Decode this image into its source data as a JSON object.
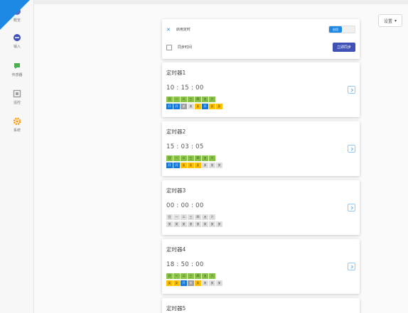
{
  "sidebar": {
    "items": [
      {
        "label": "概览",
        "icon": "dashboard-icon",
        "color": "#5c6bc0"
      },
      {
        "label": "输入",
        "icon": "input-icon",
        "color": "#3f51b5"
      },
      {
        "label": "传感器",
        "icon": "sensor-icon",
        "color": "#4caf50"
      },
      {
        "label": "遥控",
        "icon": "remote-icon",
        "color": "#9e9e9e"
      },
      {
        "label": "系统",
        "icon": "gear-icon",
        "color": "#ff9800"
      }
    ]
  },
  "header": {
    "settings_label": "设置"
  },
  "top_card": {
    "enable_label": "启用定时",
    "toggle_label": "启用",
    "sync_label": "同步时间",
    "sync_button": "立即同步"
  },
  "timers": [
    {
      "name": "定时器1",
      "time": "10 : 15 : 00",
      "days": [
        {
          "t": "日",
          "on": true
        },
        {
          "t": "一",
          "on": true
        },
        {
          "t": "二",
          "on": true
        },
        {
          "t": "三",
          "on": true
        },
        {
          "t": "四",
          "on": true
        },
        {
          "t": "五",
          "on": true
        },
        {
          "t": "六",
          "on": true
        }
      ],
      "actions": [
        {
          "t": "开",
          "s": "b"
        },
        {
          "t": "开",
          "s": "b"
        },
        {
          "t": "关",
          "s": "g"
        },
        {
          "t": "关",
          "s": "n"
        },
        {
          "t": "反",
          "s": "y"
        },
        {
          "t": "开",
          "s": "b"
        },
        {
          "t": "反",
          "s": "y"
        },
        {
          "t": "反",
          "s": "y"
        }
      ]
    },
    {
      "name": "定时器2",
      "time": "15 : 03 : 05",
      "days": [
        {
          "t": "日",
          "on": true
        },
        {
          "t": "一",
          "on": true
        },
        {
          "t": "二",
          "on": true
        },
        {
          "t": "三",
          "on": true
        },
        {
          "t": "四",
          "on": true
        },
        {
          "t": "五",
          "on": true
        },
        {
          "t": "六",
          "on": true
        }
      ],
      "actions": [
        {
          "t": "开",
          "s": "b"
        },
        {
          "t": "开",
          "s": "b"
        },
        {
          "t": "反",
          "s": "y"
        },
        {
          "t": "反",
          "s": "y"
        },
        {
          "t": "反",
          "s": "y"
        },
        {
          "t": "关",
          "s": "n"
        },
        {
          "t": "关",
          "s": "n"
        },
        {
          "t": "关",
          "s": "n"
        }
      ]
    },
    {
      "name": "定时器3",
      "time": "00 : 00 : 00",
      "days": [
        {
          "t": "日",
          "on": false
        },
        {
          "t": "一",
          "on": false
        },
        {
          "t": "二",
          "on": false
        },
        {
          "t": "三",
          "on": false
        },
        {
          "t": "四",
          "on": false
        },
        {
          "t": "五",
          "on": false
        },
        {
          "t": "六",
          "on": false
        }
      ],
      "actions": [
        {
          "t": "关",
          "s": "n"
        },
        {
          "t": "关",
          "s": "n"
        },
        {
          "t": "关",
          "s": "n"
        },
        {
          "t": "关",
          "s": "n"
        },
        {
          "t": "关",
          "s": "n"
        },
        {
          "t": "关",
          "s": "n"
        },
        {
          "t": "关",
          "s": "n"
        },
        {
          "t": "关",
          "s": "n"
        }
      ]
    },
    {
      "name": "定时器4",
      "time": "18 : 50 : 00",
      "days": [
        {
          "t": "日",
          "on": true
        },
        {
          "t": "一",
          "on": true
        },
        {
          "t": "二",
          "on": true
        },
        {
          "t": "三",
          "on": true
        },
        {
          "t": "四",
          "on": true
        },
        {
          "t": "五",
          "on": true
        },
        {
          "t": "六",
          "on": true
        }
      ],
      "actions": [
        {
          "t": "反",
          "s": "y"
        },
        {
          "t": "反",
          "s": "y"
        },
        {
          "t": "开",
          "s": "b"
        },
        {
          "t": "关",
          "s": "g"
        },
        {
          "t": "反",
          "s": "y"
        },
        {
          "t": "关",
          "s": "n"
        },
        {
          "t": "关",
          "s": "n"
        },
        {
          "t": "关",
          "s": "n"
        }
      ]
    },
    {
      "name": "定时器5"
    }
  ],
  "colors": {
    "accent": "#1e88e5",
    "button": "#3f51b5",
    "day_on": "#8bc34a"
  }
}
